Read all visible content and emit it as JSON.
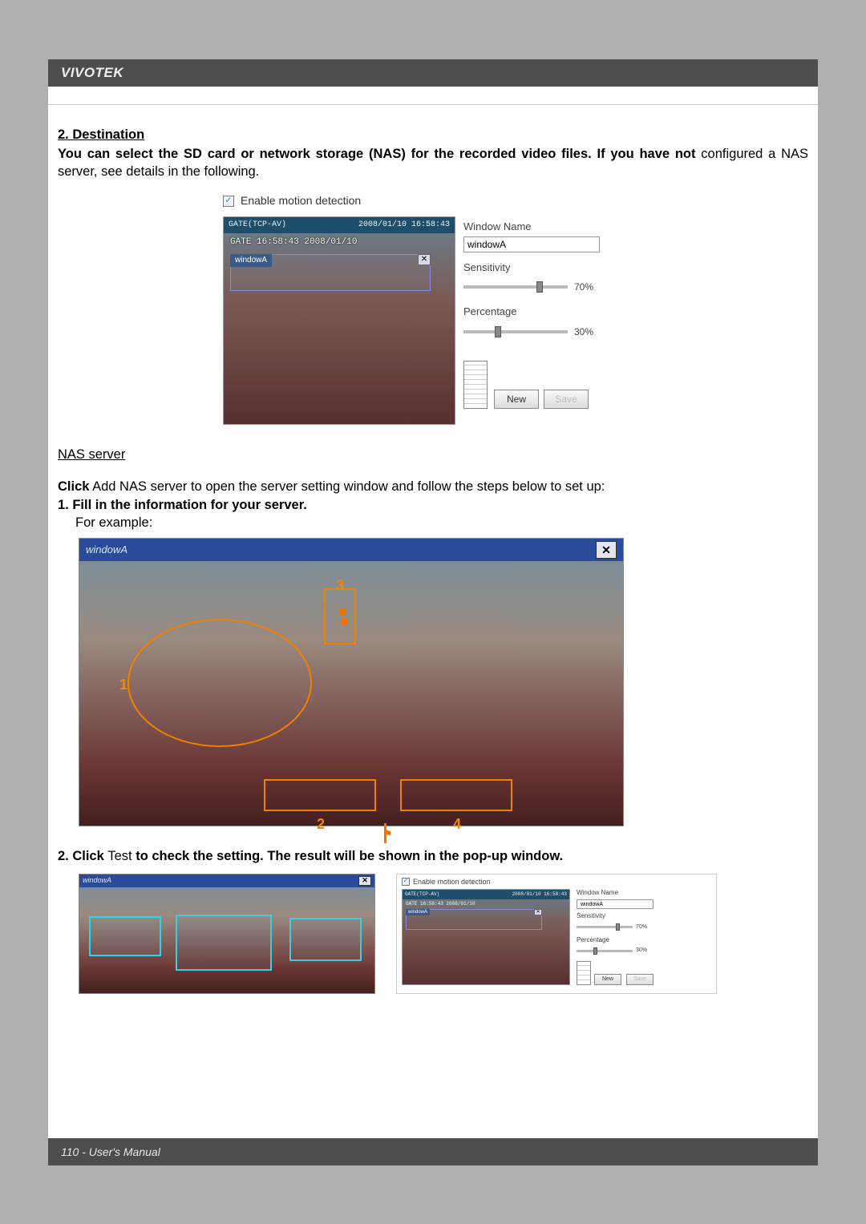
{
  "brand": "VIVOTEK",
  "footer": "110 - User's Manual",
  "section": {
    "title": "2. Destination",
    "para_a_bold": "You can select the SD card or network storage (NAS) for the recorded video files. If you have not ",
    "para_a_tail": "configured a NAS server, see details in the following."
  },
  "fig1": {
    "enable_label": "Enable motion detection",
    "bar_left": "GATE(TCP-AV)",
    "bar_right": "2008/01/10 16:58:43",
    "osd": "GATE 16:58:43 2008/01/10",
    "md_window_label": "windowA",
    "right": {
      "name_label": "Window Name",
      "name_value": "windowA",
      "sens_label": "Sensitivity",
      "sens_value": "70%",
      "sens_knob_pct": 70,
      "perc_label": "Percentage",
      "perc_value": "30%",
      "perc_knob_pct": 30,
      "btn_new": "New",
      "btn_save": "Save"
    }
  },
  "nas": {
    "heading": "NAS server",
    "line1_a": "Click",
    "line1_b": " Add NAS server  to open the server setting window and follow the steps below to set up:",
    "step1_bold": "1. Fill in the information for your server.",
    "step1_eg": "For example:"
  },
  "fig2": {
    "title": "windowA",
    "annot1": "1",
    "annot2": "2",
    "annot3": "3",
    "annot4": "4"
  },
  "step2": {
    "lead": "2. Click ",
    "mid": "Test",
    "tail": " to check the setting. The result will be shown in the pop-up window."
  },
  "fig3a": {
    "title": "windowA"
  },
  "fig3b": {
    "enable_label": "Enable motion detection",
    "bar_left": "GATE(TCP-AV)",
    "bar_right": "2008/01/10 16:58:43",
    "osd": "GATE 16:58:43 2008/01/10",
    "md_window_label": "windowA",
    "name_label": "Window Name",
    "name_value": "windowA",
    "sens_label": "Sensitivity",
    "sens_value": "70%",
    "perc_label": "Percentage",
    "perc_value": "30%",
    "btn_new": "New",
    "btn_save": "Save"
  }
}
